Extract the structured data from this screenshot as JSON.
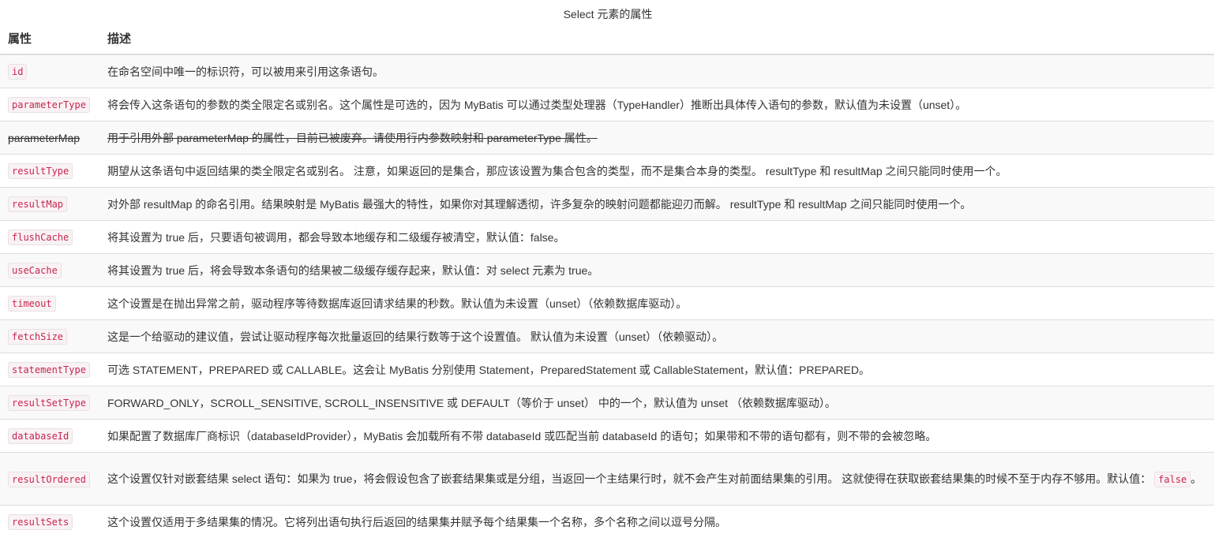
{
  "caption": "Select 元素的属性",
  "header": {
    "col_attr": "属性",
    "col_desc": "描述"
  },
  "rows": [
    {
      "attr": "id",
      "desc": "在命名空间中唯一的标识符，可以被用来引用这条语句。"
    },
    {
      "attr": "parameterType",
      "desc": "将会传入这条语句的参数的类全限定名或别名。这个属性是可选的，因为 MyBatis 可以通过类型处理器（TypeHandler）推断出具体传入语句的参数，默认值为未设置（unset）。"
    },
    {
      "attr": "parameterMap",
      "desc": "用于引用外部 parameterMap 的属性，目前已被废弃。请使用行内参数映射和 parameterType 属性。"
    },
    {
      "attr": "resultType",
      "desc": "期望从这条语句中返回结果的类全限定名或别名。 注意，如果返回的是集合，那应该设置为集合包含的类型，而不是集合本身的类型。 resultType 和 resultMap 之间只能同时使用一个。"
    },
    {
      "attr": "resultMap",
      "desc": "对外部 resultMap 的命名引用。结果映射是 MyBatis 最强大的特性，如果你对其理解透彻，许多复杂的映射问题都能迎刃而解。 resultType 和 resultMap 之间只能同时使用一个。"
    },
    {
      "attr": "flushCache",
      "desc": "将其设置为 true 后，只要语句被调用，都会导致本地缓存和二级缓存被清空，默认值：false。"
    },
    {
      "attr": "useCache",
      "desc": "将其设置为 true 后，将会导致本条语句的结果被二级缓存缓存起来，默认值：对 select 元素为 true。"
    },
    {
      "attr": "timeout",
      "desc": "这个设置是在抛出异常之前，驱动程序等待数据库返回请求结果的秒数。默认值为未设置（unset）（依赖数据库驱动）。"
    },
    {
      "attr": "fetchSize",
      "desc": "这是一个给驱动的建议值，尝试让驱动程序每次批量返回的结果行数等于这个设置值。 默认值为未设置（unset）（依赖驱动）。"
    },
    {
      "attr": "statementType",
      "desc": "可选 STATEMENT，PREPARED 或 CALLABLE。这会让 MyBatis 分别使用 Statement，PreparedStatement 或 CallableStatement，默认值：PREPARED。"
    },
    {
      "attr": "resultSetType",
      "desc": "FORWARD_ONLY，SCROLL_SENSITIVE, SCROLL_INSENSITIVE 或 DEFAULT（等价于 unset） 中的一个，默认值为 unset （依赖数据库驱动）。"
    },
    {
      "attr": "databaseId",
      "desc": "如果配置了数据库厂商标识（databaseIdProvider），MyBatis 会加载所有不带 databaseId 或匹配当前 databaseId 的语句；如果带和不带的语句都有，则不带的会被忽略。"
    },
    {
      "attr": "resultOrdered",
      "desc": "这个设置仅针对嵌套结果 select 语句：如果为 true，将会假设包含了嵌套结果集或是分组，当返回一个主结果行时，就不会产生对前面结果集的引用。 这就使得在获取嵌套结果集的时候不至于内存不够用。默认值：",
      "desc_code": "false",
      "desc_tail": "。"
    },
    {
      "attr": "resultSets",
      "desc": "这个设置仅适用于多结果集的情况。它将列出语句执行后返回的结果集并赋予每个结果集一个名称，多个名称之间以逗号分隔。"
    }
  ]
}
